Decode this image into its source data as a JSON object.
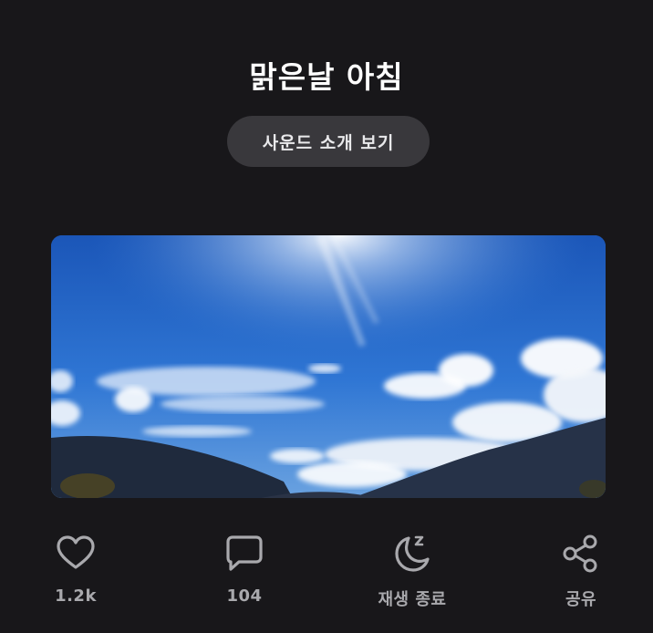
{
  "track": {
    "title": "맑은날 아침"
  },
  "intro_button": {
    "label": "사운드 소개 보기"
  },
  "cover_image": {
    "alt": "sunny morning sky over mountains"
  },
  "actions": [
    {
      "label": "1.2k",
      "icon": "heart-icon"
    },
    {
      "label": "104",
      "icon": "comment-icon"
    },
    {
      "label": "재생 종료",
      "icon": "sleep-timer-moon-icon"
    },
    {
      "label": "공유",
      "icon": "share-icon"
    }
  ],
  "colors": {
    "background": "#18171a",
    "button_bg": "#39383c",
    "icon": "#a9a9ad",
    "text": "#ffffff"
  }
}
